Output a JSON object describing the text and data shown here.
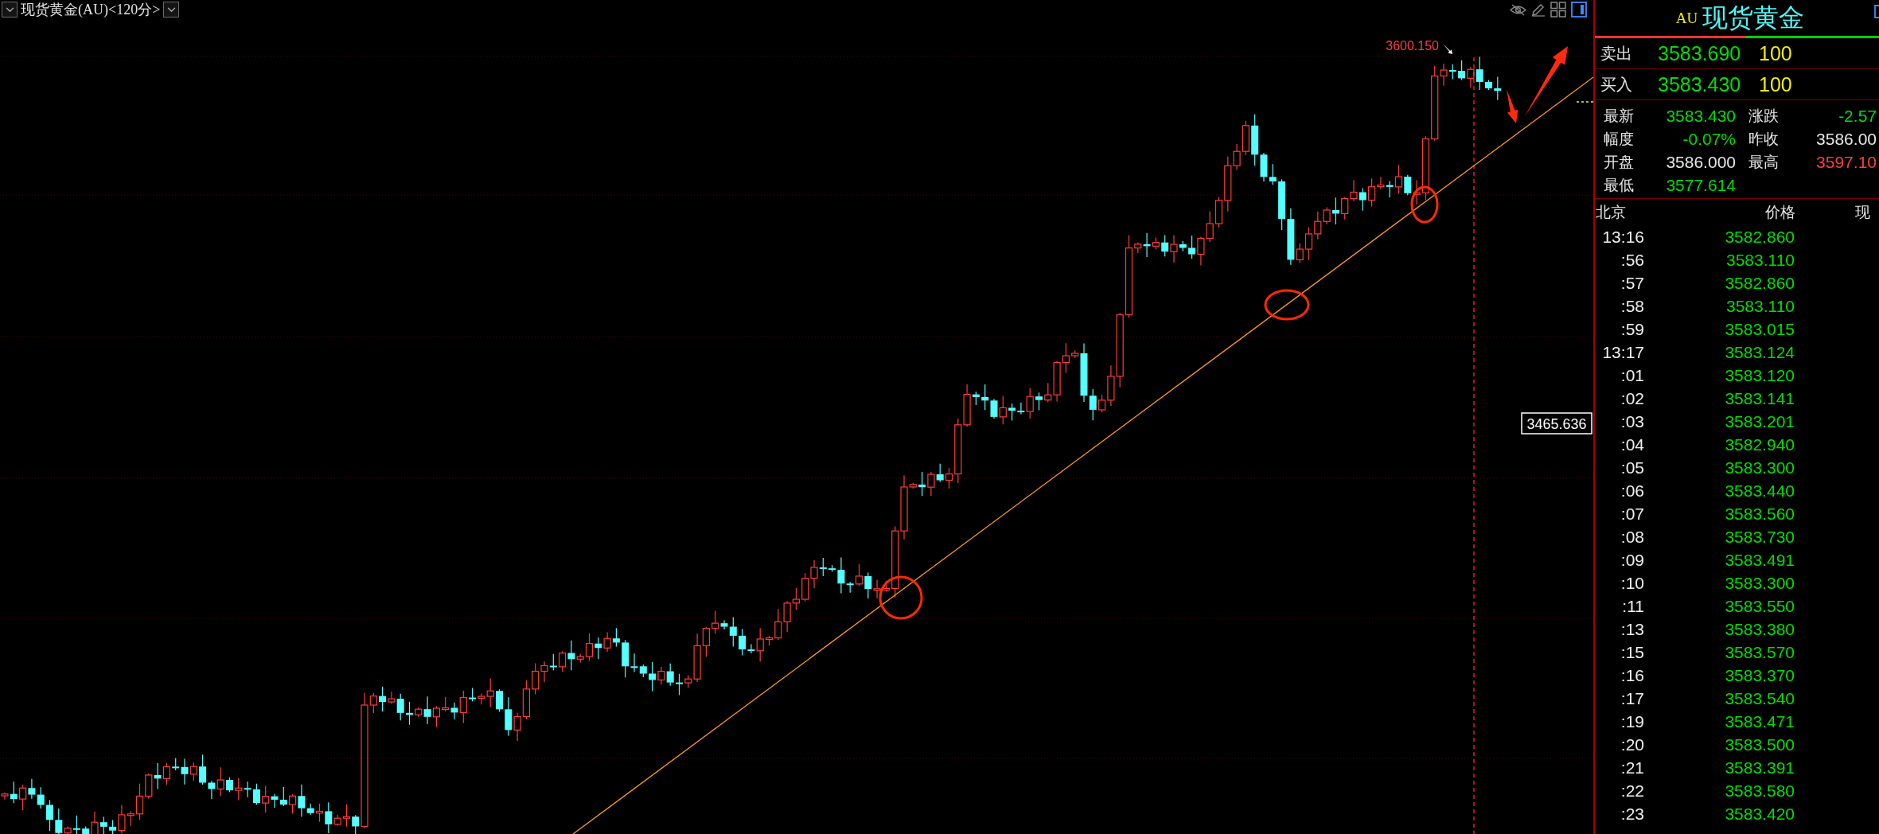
{
  "chart_header": {
    "title": "现货黄金(AU)<120分>"
  },
  "chart": {
    "high_label": "3600.150",
    "crosshair_label": "3465.636"
  },
  "quote_panel": {
    "code": "AU",
    "name": "现货黄金",
    "order_book": [
      {
        "side": "卖出",
        "price": "3583.690",
        "volume": "100"
      },
      {
        "side": "买入",
        "price": "3583.430",
        "volume": "100"
      }
    ],
    "stats": [
      {
        "label": "最新",
        "value": "3583.430",
        "color": "#00dc00"
      },
      {
        "label": "涨跌",
        "value": "-2.57",
        "color": "#00dc00"
      },
      {
        "label": "幅度",
        "value": "-0.07%",
        "color": "#00dc00"
      },
      {
        "label": "昨收",
        "value": "3586.00",
        "color": "#e6e6e6"
      },
      {
        "label": "开盘",
        "value": "3586.000",
        "color": "#e6e6e6"
      },
      {
        "label": "最高",
        "value": "3597.10",
        "color": "#ff3c3c"
      },
      {
        "label": "最低",
        "value": "3577.614",
        "color": "#00dc00"
      }
    ],
    "ticks": {
      "columns": [
        "北京",
        "价格",
        "现"
      ],
      "rows": [
        {
          "time": "13:16",
          "price": "3582.860"
        },
        {
          "time": ":56",
          "price": "3583.110"
        },
        {
          "time": ":57",
          "price": "3582.860"
        },
        {
          "time": ":58",
          "price": "3583.110"
        },
        {
          "time": ":59",
          "price": "3583.015"
        },
        {
          "time": "13:17",
          "price": "3583.124"
        },
        {
          "time": ":01",
          "price": "3583.120"
        },
        {
          "time": ":02",
          "price": "3583.141"
        },
        {
          "time": ":03",
          "price": "3583.201"
        },
        {
          "time": ":04",
          "price": "3582.940"
        },
        {
          "time": ":05",
          "price": "3583.300"
        },
        {
          "time": ":06",
          "price": "3583.440"
        },
        {
          "time": ":07",
          "price": "3583.560"
        },
        {
          "time": ":08",
          "price": "3583.730"
        },
        {
          "time": ":09",
          "price": "3583.491"
        },
        {
          "time": ":10",
          "price": "3583.300"
        },
        {
          "time": ":11",
          "price": "3583.550"
        },
        {
          "time": ":13",
          "price": "3583.380"
        },
        {
          "time": ":15",
          "price": "3583.570"
        },
        {
          "time": ":16",
          "price": "3583.370"
        },
        {
          "time": ":17",
          "price": "3583.540"
        },
        {
          "time": ":19",
          "price": "3583.471"
        },
        {
          "time": ":20",
          "price": "3583.500"
        },
        {
          "time": ":21",
          "price": "3583.391"
        },
        {
          "time": ":22",
          "price": "3583.580"
        },
        {
          "time": ":23",
          "price": "3583.420"
        }
      ]
    }
  }
}
